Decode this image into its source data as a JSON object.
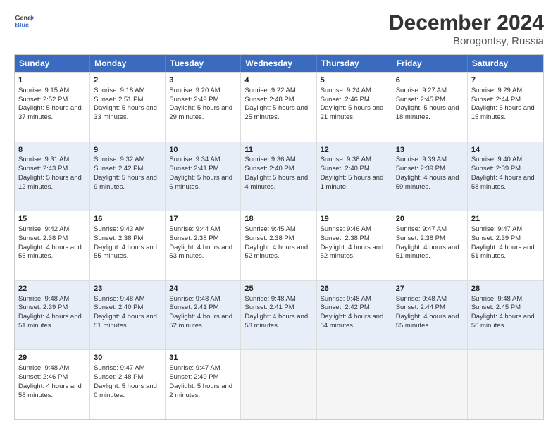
{
  "header": {
    "logo_line1": "General",
    "logo_line2": "Blue",
    "title": "December 2024",
    "subtitle": "Borogontsy, Russia"
  },
  "days_of_week": [
    "Sunday",
    "Monday",
    "Tuesday",
    "Wednesday",
    "Thursday",
    "Friday",
    "Saturday"
  ],
  "weeks": [
    [
      {
        "day": 1,
        "sunrise": "9:15 AM",
        "sunset": "2:52 PM",
        "daylight": "5 hours and 37 minutes."
      },
      {
        "day": 2,
        "sunrise": "9:18 AM",
        "sunset": "2:51 PM",
        "daylight": "5 hours and 33 minutes."
      },
      {
        "day": 3,
        "sunrise": "9:20 AM",
        "sunset": "2:49 PM",
        "daylight": "5 hours and 29 minutes."
      },
      {
        "day": 4,
        "sunrise": "9:22 AM",
        "sunset": "2:48 PM",
        "daylight": "5 hours and 25 minutes."
      },
      {
        "day": 5,
        "sunrise": "9:24 AM",
        "sunset": "2:46 PM",
        "daylight": "5 hours and 21 minutes."
      },
      {
        "day": 6,
        "sunrise": "9:27 AM",
        "sunset": "2:45 PM",
        "daylight": "5 hours and 18 minutes."
      },
      {
        "day": 7,
        "sunrise": "9:29 AM",
        "sunset": "2:44 PM",
        "daylight": "5 hours and 15 minutes."
      }
    ],
    [
      {
        "day": 8,
        "sunrise": "9:31 AM",
        "sunset": "2:43 PM",
        "daylight": "5 hours and 12 minutes."
      },
      {
        "day": 9,
        "sunrise": "9:32 AM",
        "sunset": "2:42 PM",
        "daylight": "5 hours and 9 minutes."
      },
      {
        "day": 10,
        "sunrise": "9:34 AM",
        "sunset": "2:41 PM",
        "daylight": "5 hours and 6 minutes."
      },
      {
        "day": 11,
        "sunrise": "9:36 AM",
        "sunset": "2:40 PM",
        "daylight": "5 hours and 4 minutes."
      },
      {
        "day": 12,
        "sunrise": "9:38 AM",
        "sunset": "2:40 PM",
        "daylight": "5 hours and 1 minute."
      },
      {
        "day": 13,
        "sunrise": "9:39 AM",
        "sunset": "2:39 PM",
        "daylight": "4 hours and 59 minutes."
      },
      {
        "day": 14,
        "sunrise": "9:40 AM",
        "sunset": "2:39 PM",
        "daylight": "4 hours and 58 minutes."
      }
    ],
    [
      {
        "day": 15,
        "sunrise": "9:42 AM",
        "sunset": "2:38 PM",
        "daylight": "4 hours and 56 minutes."
      },
      {
        "day": 16,
        "sunrise": "9:43 AM",
        "sunset": "2:38 PM",
        "daylight": "4 hours and 55 minutes."
      },
      {
        "day": 17,
        "sunrise": "9:44 AM",
        "sunset": "2:38 PM",
        "daylight": "4 hours and 53 minutes."
      },
      {
        "day": 18,
        "sunrise": "9:45 AM",
        "sunset": "2:38 PM",
        "daylight": "4 hours and 52 minutes."
      },
      {
        "day": 19,
        "sunrise": "9:46 AM",
        "sunset": "2:38 PM",
        "daylight": "4 hours and 52 minutes."
      },
      {
        "day": 20,
        "sunrise": "9:47 AM",
        "sunset": "2:38 PM",
        "daylight": "4 hours and 51 minutes."
      },
      {
        "day": 21,
        "sunrise": "9:47 AM",
        "sunset": "2:39 PM",
        "daylight": "4 hours and 51 minutes."
      }
    ],
    [
      {
        "day": 22,
        "sunrise": "9:48 AM",
        "sunset": "2:39 PM",
        "daylight": "4 hours and 51 minutes."
      },
      {
        "day": 23,
        "sunrise": "9:48 AM",
        "sunset": "2:40 PM",
        "daylight": "4 hours and 51 minutes."
      },
      {
        "day": 24,
        "sunrise": "9:48 AM",
        "sunset": "2:41 PM",
        "daylight": "4 hours and 52 minutes."
      },
      {
        "day": 25,
        "sunrise": "9:48 AM",
        "sunset": "2:41 PM",
        "daylight": "4 hours and 53 minutes."
      },
      {
        "day": 26,
        "sunrise": "9:48 AM",
        "sunset": "2:42 PM",
        "daylight": "4 hours and 54 minutes."
      },
      {
        "day": 27,
        "sunrise": "9:48 AM",
        "sunset": "2:44 PM",
        "daylight": "4 hours and 55 minutes."
      },
      {
        "day": 28,
        "sunrise": "9:48 AM",
        "sunset": "2:45 PM",
        "daylight": "4 hours and 56 minutes."
      }
    ],
    [
      {
        "day": 29,
        "sunrise": "9:48 AM",
        "sunset": "2:46 PM",
        "daylight": "4 hours and 58 minutes."
      },
      {
        "day": 30,
        "sunrise": "9:47 AM",
        "sunset": "2:48 PM",
        "daylight": "5 hours and 0 minutes."
      },
      {
        "day": 31,
        "sunrise": "9:47 AM",
        "sunset": "2:49 PM",
        "daylight": "5 hours and 2 minutes."
      },
      null,
      null,
      null,
      null
    ]
  ]
}
